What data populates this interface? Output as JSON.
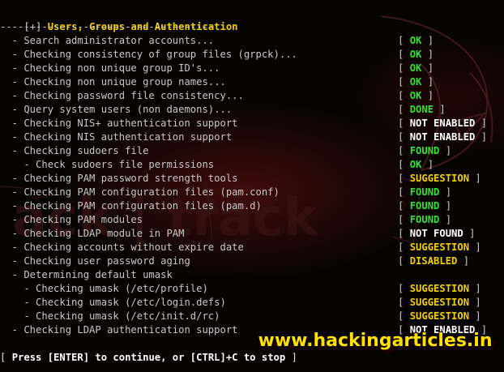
{
  "header": {
    "bracket": "[+]",
    "title": "Users, Groups and Authentication",
    "separator": "------------------------------------"
  },
  "checks": [
    {
      "label": "  - Search administrator accounts...",
      "status": "OK",
      "color": "green"
    },
    {
      "label": "  - Checking consistency of group files (grpck)...",
      "status": "OK",
      "color": "green"
    },
    {
      "label": "  - Checking non unique group ID's...",
      "status": "OK",
      "color": "green"
    },
    {
      "label": "  - Checking non unique group names...",
      "status": "OK",
      "color": "green"
    },
    {
      "label": "  - Checking password file consistency...",
      "status": "OK",
      "color": "green"
    },
    {
      "label": "  - Query system users (non daemons)...",
      "status": "DONE",
      "color": "green"
    },
    {
      "label": "  - Checking NIS+ authentication support",
      "status": "NOT ENABLED",
      "color": "white"
    },
    {
      "label": "  - Checking NIS authentication support",
      "status": "NOT ENABLED",
      "color": "white"
    },
    {
      "label": "  - Checking sudoers file",
      "status": "FOUND",
      "color": "green"
    },
    {
      "label": "    - Check sudoers file permissions",
      "status": "OK",
      "color": "green"
    },
    {
      "label": "  - Checking PAM password strength tools",
      "status": "SUGGESTION",
      "color": "yellow"
    },
    {
      "label": "  - Checking PAM configuration files (pam.conf)",
      "status": "FOUND",
      "color": "green"
    },
    {
      "label": "  - Checking PAM configuration files (pam.d)",
      "status": "FOUND",
      "color": "green"
    },
    {
      "label": "  - Checking PAM modules",
      "status": "FOUND",
      "color": "green"
    },
    {
      "label": "  - Checking LDAP module in PAM",
      "status": "NOT FOUND",
      "color": "white"
    },
    {
      "label": "  - Checking accounts without expire date",
      "status": "SUGGESTION",
      "color": "yellow"
    },
    {
      "label": "  - Checking user password aging",
      "status": "DISABLED",
      "color": "yellow"
    },
    {
      "label": "  - Determining default umask",
      "status": "",
      "color": ""
    },
    {
      "label": "    - Checking umask (/etc/profile)",
      "status": "SUGGESTION",
      "color": "yellow"
    },
    {
      "label": "    - Checking umask (/etc/login.defs)",
      "status": "SUGGESTION",
      "color": "yellow"
    },
    {
      "label": "    - Checking umask (/etc/init.d/rc)",
      "status": "SUGGESTION",
      "color": "yellow"
    },
    {
      "label": "  - Checking LDAP authentication support",
      "status": "NOT ENABLED",
      "color": "white"
    }
  ],
  "prompt": {
    "open": "[ ",
    "text": "Press [ENTER] to continue, or [CTRL]+C to stop",
    "close": " ]"
  },
  "watermark": "www.hackingarticles.in"
}
